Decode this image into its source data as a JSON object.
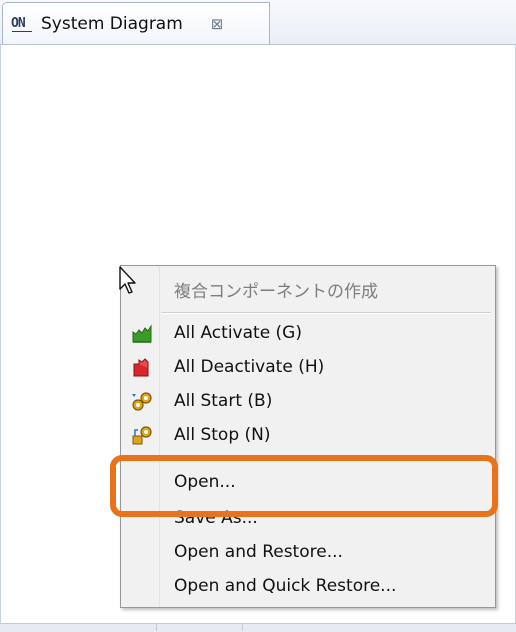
{
  "editor": {
    "tab_title": "System Diagram",
    "tab_icon": "ON",
    "close_glyph": "⊠"
  },
  "context_menu": {
    "items": [
      {
        "label": "複合コンポーネントの作成",
        "icon": "none",
        "enabled": false
      },
      {
        "label": "All Activate (G)",
        "icon": "activate-icon",
        "enabled": true
      },
      {
        "label": "All Deactivate (H)",
        "icon": "deactivate-icon",
        "enabled": true
      },
      {
        "label": "All Start (B)",
        "icon": "start-icon",
        "enabled": true
      },
      {
        "label": "All Stop (N)",
        "icon": "stop-icon",
        "enabled": true
      },
      {
        "label": "Open...",
        "icon": "none",
        "enabled": true,
        "highlighted": true
      },
      {
        "label": "Save As...",
        "icon": "none",
        "enabled": true
      },
      {
        "label": "Open and Restore...",
        "icon": "none",
        "enabled": true
      },
      {
        "label": "Open and Quick Restore...",
        "icon": "none",
        "enabled": true
      }
    ]
  },
  "colors": {
    "highlight_border": "#e8731b",
    "menu_background": "#f1f1f1",
    "activate_green": "#3c9a2a",
    "deactivate_red": "#d9262b"
  }
}
